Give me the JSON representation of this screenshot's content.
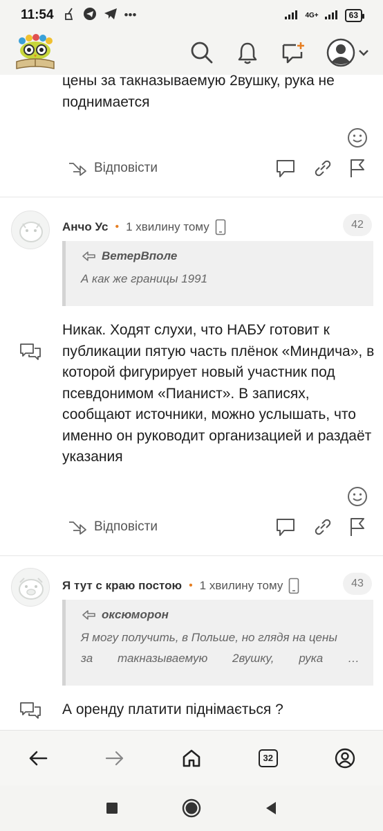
{
  "status_bar": {
    "time": "11:54",
    "network_label": "4G+",
    "battery": "63"
  },
  "header": {
    "logo_icon": "site-logo-owl-on-book",
    "search_icon": "search-icon",
    "notifications_icon": "bell-icon",
    "new_post_icon": "new-comment-icon",
    "profile_icon": "user-avatar-icon"
  },
  "partial_comment": {
    "text_line_1": "цены за такназываемую 2вушку, рука не",
    "text_line_2": "поднимается",
    "reply_label": "Відповісти"
  },
  "comments": [
    {
      "author": "Анчо Ус",
      "time": "1 хвилину тому",
      "number": "42",
      "quote_author": "ВетерВполе",
      "quote_text": "А как же границы 1991",
      "body": "Никак. Ходят слухи, что НАБУ готовит к публикации пятую часть плёнок «Миндича», в которой фигурирует новый участник под псевдонимом «Пианист». В записях, сообщают источники, можно услышать, что именно он руководит организацией и раздаёт указания",
      "reply_label": "Відповісти"
    },
    {
      "author": "Я тут с краю постою",
      "time": "1 хвилину тому",
      "number": "43",
      "quote_author": "оксюморон",
      "quote_line_1": "Я могу получить, в Польше, но глядя на цены",
      "quote_line_2_words": [
        "за",
        "такназываемую",
        "2вушку,",
        "рука",
        "…"
      ],
      "body": "А оренду платити піднімається ?"
    }
  ],
  "bottom_nav": {
    "back_icon": "arrow-left-icon",
    "forward_icon": "arrow-right-icon",
    "home_icon": "home-icon",
    "tabs_count": "32",
    "account_icon": "account-circle-icon"
  },
  "colors": {
    "accent_orange": "#e67e22",
    "bar_background": "#f4f4f2",
    "quote_background": "#f0f0f0"
  }
}
